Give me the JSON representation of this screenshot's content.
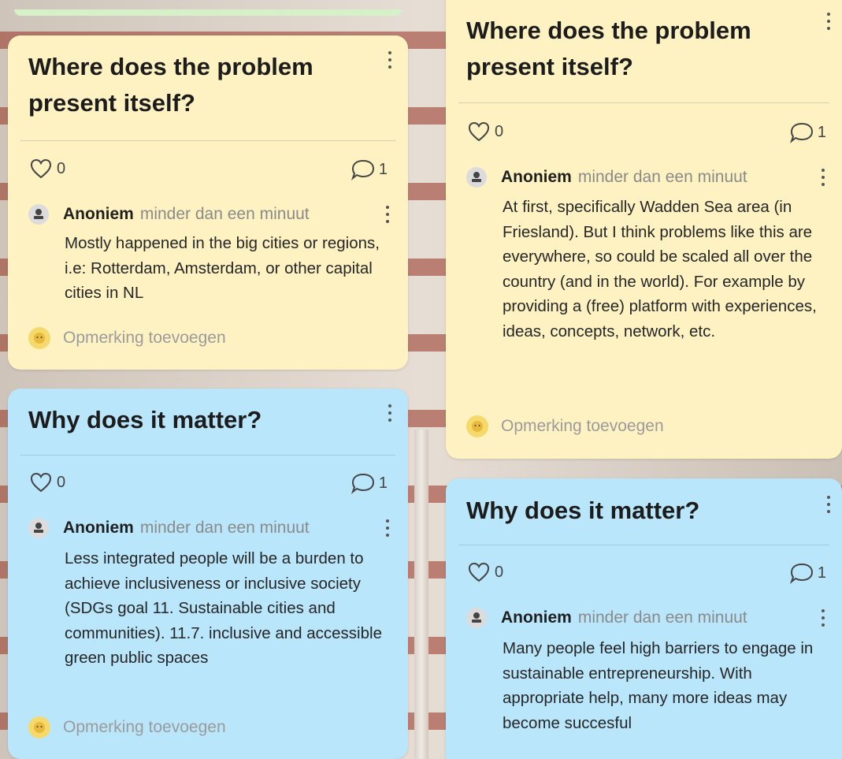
{
  "cards": [
    {
      "title": "Where does the problem present itself?",
      "likes": "0",
      "comments": "1",
      "author": "Anoniem",
      "time": "minder dan een minuut",
      "text": "Mostly happened in the big cities or regions, i.e: Rotterdam, Amsterdam, or other capital cities in NL",
      "add_comment": "Opmerking toevoegen"
    },
    {
      "title": "Why does it matter?",
      "likes": "0",
      "comments": "1",
      "author": "Anoniem",
      "time": "minder dan een minuut",
      "text": "Less integrated people will be a burden to achieve inclusiveness or inclusive society (SDGs goal 11. Sustainable cities and communities). 11.7. inclusive and accessible green public spaces",
      "add_comment": "Opmerking toevoegen"
    },
    {
      "title": "Where does the problem present itself?",
      "likes": "0",
      "comments": "1",
      "author": "Anoniem",
      "time": "minder dan een minuut",
      "text": "At first, specifically Wadden Sea area (in Friesland). But I think problems like this are everywhere, so could be scaled all over the country (and in the world). For example by providing a (free) platform with experiences, ideas, concepts, network, etc.",
      "add_comment": "Opmerking toevoegen"
    },
    {
      "title": "Why does it matter?",
      "likes": "0",
      "comments": "1",
      "author": "Anoniem",
      "time": "minder dan een minuut",
      "text": "Many people feel high barriers to engage in sustainable entrepreneurship. With appropriate help, many more ideas may become succesful"
    }
  ],
  "colors": {
    "yellow_card": "#fff2c2",
    "blue_card": "#b9e6fb"
  },
  "icons": {
    "like": "heart-outline-icon",
    "comment": "speech-bubble-icon",
    "menu": "vertical-dots-icon",
    "avatar": "anonymous-user-icon"
  }
}
